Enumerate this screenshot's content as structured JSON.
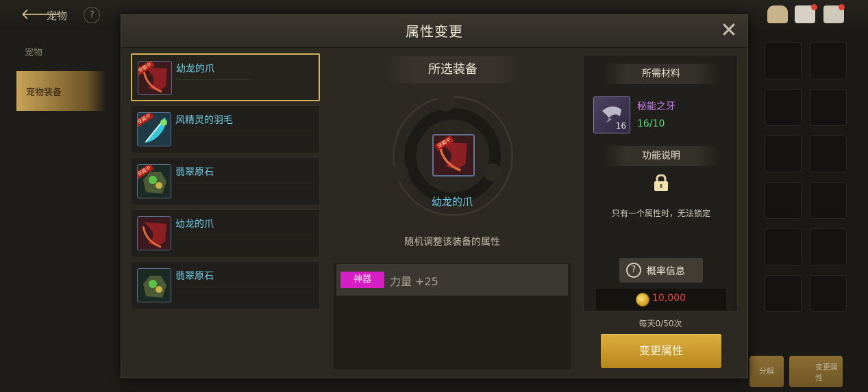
{
  "background": {
    "title": "宠物",
    "side_items": [
      "宠物",
      "宠物装备"
    ],
    "bottom_buttons": [
      "分解",
      "变更属性"
    ]
  },
  "modal": {
    "title": "属性变更",
    "close_icon": "close-icon"
  },
  "items": [
    {
      "name": "幼龙的爪",
      "equipped": true,
      "selected": true,
      "icon": "claw-icon",
      "tag": "穿戴中"
    },
    {
      "name": "风精灵的羽毛",
      "equipped": true,
      "selected": false,
      "icon": "feather-icon",
      "tag": "穿戴中"
    },
    {
      "name": "翡翠原石",
      "equipped": true,
      "selected": false,
      "icon": "emerald-ore-icon",
      "tag": "穿戴中"
    },
    {
      "name": "幼龙的爪",
      "equipped": false,
      "selected": false,
      "icon": "claw-icon",
      "tag": ""
    },
    {
      "name": "翡翠原石",
      "equipped": false,
      "selected": false,
      "icon": "emerald-ore-icon",
      "tag": ""
    }
  ],
  "center": {
    "section_title": "所选装备",
    "selected_item_name": "幼龙的爪",
    "selected_item_tag": "穿戴中",
    "description": "随机调整该装备的属性",
    "attribute": {
      "badge": "神器",
      "text": "力量 +25",
      "badge_color": "#d61fc2"
    }
  },
  "right": {
    "materials_title": "所需材料",
    "material": {
      "name": "秘能之牙",
      "count": "16",
      "qty": "16/10",
      "icon": "fang-icon"
    },
    "function_title": "功能说明",
    "lock_icon": "lock-icon",
    "lock_text": "只有一个属性时，无法锁定",
    "probability_button": "概率信息",
    "cost": "10,000",
    "daily_limit": "每天0/50次",
    "change_button": "变更属性"
  },
  "colors": {
    "item_name": "#6fd0e8",
    "material_name": "#c77ef0",
    "material_qty": "#57e07d",
    "cost": "#e8483a",
    "accent_gold": "#d2b358"
  }
}
